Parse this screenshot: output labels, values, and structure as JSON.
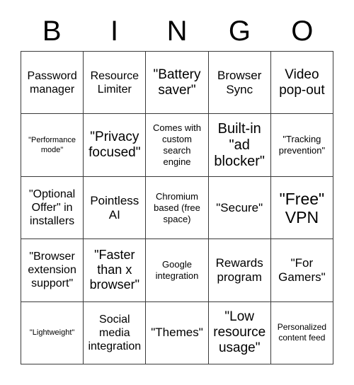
{
  "card": {
    "header_letters": [
      "B",
      "I",
      "N",
      "G",
      "O"
    ],
    "grid": {
      "columns": 5,
      "rows": 5,
      "border_color": "#3a3a3a",
      "cell_background": "#ffffff",
      "text_color": "#000000"
    },
    "cells": [
      {
        "text": "Password manager",
        "size": "fs-16",
        "row": 1,
        "col": 1
      },
      {
        "text": "Resource Limiter",
        "size": "fs-16",
        "row": 1,
        "col": 2
      },
      {
        "text": "\"Battery saver\"",
        "size": "fs-19",
        "row": 1,
        "col": 3
      },
      {
        "text": "Browser Sync",
        "size": "fs-17",
        "row": 1,
        "col": 4
      },
      {
        "text": "Video pop-out",
        "size": "fs-19",
        "row": 1,
        "col": 5
      },
      {
        "text": "\"Performance mode\"",
        "size": "fs-11",
        "row": 2,
        "col": 1
      },
      {
        "text": "\"Privacy focused\"",
        "size": "fs-19",
        "row": 2,
        "col": 2
      },
      {
        "text": "Comes with custom search engine",
        "size": "fs-13",
        "row": 2,
        "col": 3
      },
      {
        "text": "Built-in \"ad blocker\"",
        "size": "fs-20",
        "row": 2,
        "col": 4
      },
      {
        "text": "\"Tracking prevention\"",
        "size": "fs-13",
        "row": 2,
        "col": 5
      },
      {
        "text": "\"Optional Offer\" in installers",
        "size": "fs-16",
        "row": 3,
        "col": 1
      },
      {
        "text": "Pointless AI",
        "size": "fs-17",
        "row": 3,
        "col": 2
      },
      {
        "text": "Chromium based (free space)",
        "size": "fs-13",
        "row": 3,
        "col": 3
      },
      {
        "text": "\"Secure\"",
        "size": "fs-17",
        "row": 3,
        "col": 4
      },
      {
        "text": "\"Free\" VPN",
        "size": "fs-23",
        "row": 3,
        "col": 5
      },
      {
        "text": "\"Browser extension support\"",
        "size": "fs-16",
        "row": 4,
        "col": 1
      },
      {
        "text": "\"Faster than x browser\"",
        "size": "fs-18",
        "row": 4,
        "col": 2
      },
      {
        "text": "Google integration",
        "size": "fs-13",
        "row": 4,
        "col": 3
      },
      {
        "text": "Rewards program",
        "size": "fs-17",
        "row": 4,
        "col": 4
      },
      {
        "text": "\"For Gamers\"",
        "size": "fs-17",
        "row": 4,
        "col": 5
      },
      {
        "text": "\"Lightweight\"",
        "size": "fs-11",
        "row": 5,
        "col": 1
      },
      {
        "text": "Social media integration",
        "size": "fs-16",
        "row": 5,
        "col": 2
      },
      {
        "text": "\"Themes\"",
        "size": "fs-17",
        "row": 5,
        "col": 3
      },
      {
        "text": "\"Low resource usage\"",
        "size": "fs-19",
        "row": 5,
        "col": 4
      },
      {
        "text": "Personalized content feed",
        "size": "fs-12",
        "row": 5,
        "col": 5
      }
    ]
  }
}
